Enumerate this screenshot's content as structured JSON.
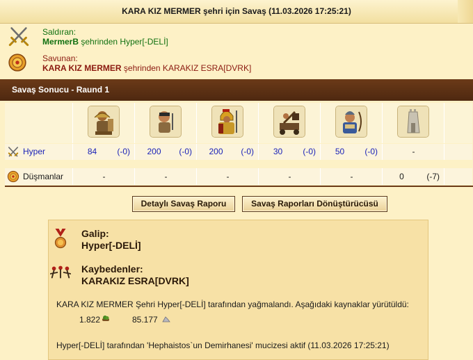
{
  "header": {
    "title": "KARA KIZ MERMER şehri için Savaş (11.03.2026 17:25:21)"
  },
  "attacker": {
    "label": "Saldıran:",
    "player": "MermerB",
    "rest": " şehrinden Hyper[-DELİ]",
    "icon": "crossed-swords-icon"
  },
  "defender": {
    "label": "Savunan:",
    "player": "KARA KIZ MERMER",
    "rest": " şehrinden KARAKIZ ESRA[DVRK]",
    "icon": "shield-icon"
  },
  "section": {
    "title": "Savaş Sonucu - Raund 1"
  },
  "units": [
    {
      "icon": "hoplite-unit-icon"
    },
    {
      "icon": "slinger-unit-icon"
    },
    {
      "icon": "swordsman-unit-icon"
    },
    {
      "icon": "catapult-unit-icon"
    },
    {
      "icon": "archer-unit-icon"
    },
    {
      "icon": "wall-icon"
    }
  ],
  "hyper_row": {
    "label": "Hyper",
    "values": [
      {
        "num": "84",
        "loss": "(-0)"
      },
      {
        "num": "200",
        "loss": "(-0)"
      },
      {
        "num": "200",
        "loss": "(-0)"
      },
      {
        "num": "30",
        "loss": "(-0)"
      },
      {
        "num": "50",
        "loss": "(-0)"
      },
      {
        "num": "-",
        "loss": ""
      }
    ]
  },
  "enemy_row": {
    "label": "Düşmanlar",
    "values": [
      {
        "num": "-",
        "loss": ""
      },
      {
        "num": "-",
        "loss": ""
      },
      {
        "num": "-",
        "loss": ""
      },
      {
        "num": "-",
        "loss": ""
      },
      {
        "num": "-",
        "loss": ""
      },
      {
        "num": "0",
        "loss": "(-7)"
      }
    ]
  },
  "buttons": {
    "detailed": "Detaylı Savaş Raporu",
    "converter": "Savaş Raporları Dönüştürücüsü"
  },
  "result": {
    "winner_label": "Galip:",
    "winner_name": "Hyper[-DELİ]",
    "losers_label": "Kaybedenler:",
    "losers_name": "KARAKIZ ESRA[DVRK]",
    "plunder_text": "KARA KIZ MERMER Şehri Hyper[-DELİ] tarafından yağmalandı. Aşağıdaki kaynaklar yürütüldü:",
    "wood": "1.822",
    "marble": "85.177",
    "miracle_text": "Hyper[-DELİ] tarafından 'Hephaistos`un Demirhanesi' mucizesi aktif (11.03.2026 17:25:21)"
  },
  "colors": {
    "attacker": "#107010",
    "defender": "#8b1a10",
    "section_bar": "#5a3014",
    "unit_numbers": "#1a22b8"
  }
}
